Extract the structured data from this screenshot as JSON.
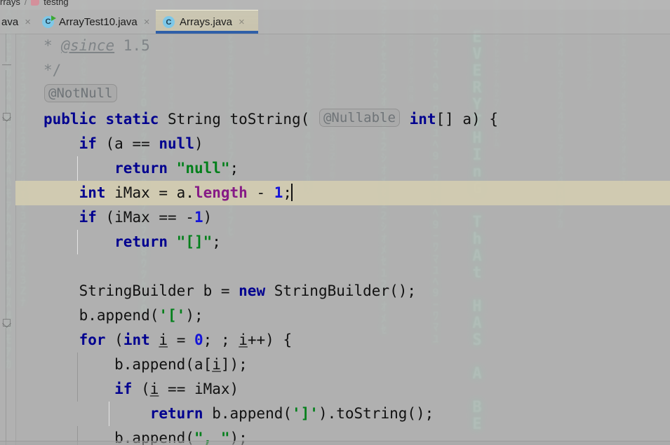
{
  "window": {
    "app": "IntelliJ IDEA Editor",
    "background_effect": "matrix-digital-rain"
  },
  "breadcrumb": {
    "items": [
      {
        "label": "rrays",
        "icon": "folder-icon"
      },
      {
        "label": "testng",
        "icon": "folder-icon"
      }
    ],
    "separator": "/"
  },
  "tabs": [
    {
      "label": "ava",
      "icon": "java-class-icon",
      "active": false,
      "has_run_marker": false,
      "close": "×"
    },
    {
      "label": "ArrayTest10.java",
      "icon": "java-class-icon",
      "active": false,
      "has_run_marker": true,
      "close": "×"
    },
    {
      "label": "Arrays.java",
      "icon": "java-class-icon",
      "active": true,
      "has_run_marker": false,
      "close": "×"
    }
  ],
  "editor": {
    "file": "Arrays.java",
    "language": "Java",
    "caret_line_index": 4,
    "caret_text": "int iMax = a.length - 1;",
    "colors": {
      "keyword": "#00008f",
      "string": "#007f1a",
      "number": "#1414d8",
      "field": "#861b86",
      "comment": "#7f8487",
      "caret_line_bg": "#d4cdb0",
      "editor_bg": "#b0b0b0",
      "active_tab_underline": "#2f5fa8"
    },
    "lines": [
      {
        "tokens": [
          {
            "t": "* ",
            "c": "cmt"
          },
          {
            "t": "@since",
            "c": "cmt-tag"
          },
          {
            "t": " 1.5",
            "c": "cmt"
          }
        ]
      },
      {
        "tokens": [
          {
            "t": "*/",
            "c": "cmt"
          }
        ]
      },
      {
        "tokens": [
          {
            "t": "@NotNull",
            "c": "inlay"
          }
        ]
      },
      {
        "tokens": [
          {
            "t": "public",
            "c": "kw"
          },
          {
            "t": " "
          },
          {
            "t": "static",
            "c": "kw"
          },
          {
            "t": " String toString( "
          },
          {
            "t": "@Nullable",
            "c": "inlay"
          },
          {
            "t": " "
          },
          {
            "t": "int",
            "c": "kw"
          },
          {
            "t": "[] a) {"
          }
        ]
      },
      {
        "tokens": [
          {
            "t": "    "
          },
          {
            "t": "if",
            "c": "kw"
          },
          {
            "t": " (a == "
          },
          {
            "t": "null",
            "c": "kw"
          },
          {
            "t": ")"
          }
        ]
      },
      {
        "tokens": [
          {
            "t": "        "
          },
          {
            "t": "return",
            "c": "kw"
          },
          {
            "t": " "
          },
          {
            "t": "\"null\"",
            "c": "str"
          },
          {
            "t": ";"
          }
        ]
      },
      {
        "tokens": [
          {
            "t": "    "
          },
          {
            "t": "int",
            "c": "kw"
          },
          {
            "t": " iMax = a."
          },
          {
            "t": "length",
            "c": "fld"
          },
          {
            "t": " - "
          },
          {
            "t": "1",
            "c": "num"
          },
          {
            "t": ";"
          }
        ]
      },
      {
        "tokens": [
          {
            "t": "    "
          },
          {
            "t": "if",
            "c": "kw"
          },
          {
            "t": " (iMax == -"
          },
          {
            "t": "1",
            "c": "num"
          },
          {
            "t": ")"
          }
        ]
      },
      {
        "tokens": [
          {
            "t": "        "
          },
          {
            "t": "return",
            "c": "kw"
          },
          {
            "t": " "
          },
          {
            "t": "\"[]\"",
            "c": "str"
          },
          {
            "t": ";"
          }
        ]
      },
      {
        "tokens": [
          {
            "t": ""
          }
        ]
      },
      {
        "tokens": [
          {
            "t": "    StringBuilder b = "
          },
          {
            "t": "new",
            "c": "kw"
          },
          {
            "t": " StringBuilder();"
          }
        ]
      },
      {
        "tokens": [
          {
            "t": "    b.append("
          },
          {
            "t": "'['",
            "c": "str"
          },
          {
            "t": ");"
          }
        ]
      },
      {
        "tokens": [
          {
            "t": "    "
          },
          {
            "t": "for",
            "c": "kw"
          },
          {
            "t": " ("
          },
          {
            "t": "int",
            "c": "kw"
          },
          {
            "t": " "
          },
          {
            "t": "i",
            "c": "ident-u"
          },
          {
            "t": " = "
          },
          {
            "t": "0",
            "c": "num"
          },
          {
            "t": "; ; "
          },
          {
            "t": "i",
            "c": "ident-u"
          },
          {
            "t": "++) {"
          }
        ]
      },
      {
        "tokens": [
          {
            "t": "        b.append(a["
          },
          {
            "t": "i",
            "c": "ident-u"
          },
          {
            "t": "]);"
          }
        ]
      },
      {
        "tokens": [
          {
            "t": "        "
          },
          {
            "t": "if",
            "c": "kw"
          },
          {
            "t": " ("
          },
          {
            "t": "i",
            "c": "ident-u"
          },
          {
            "t": " == iMax)"
          }
        ]
      },
      {
        "tokens": [
          {
            "t": "            "
          },
          {
            "t": "return",
            "c": "kw"
          },
          {
            "t": " b.append("
          },
          {
            "t": "']'",
            "c": "str"
          },
          {
            "t": ").toString();"
          }
        ]
      },
      {
        "tokens": [
          {
            "t": "        b.append("
          },
          {
            "t": "\", \"",
            "c": "str"
          },
          {
            "t": ");"
          }
        ]
      }
    ]
  },
  "gutter": {
    "fold_markers": [
      "fold-collapse-icon",
      "fold-expand-icon",
      "fold-expand-icon"
    ]
  },
  "matrix_rain": {
    "message_column": "EVERYTHInG ThAt HAS A BE",
    "glyph_pool": "ﾊﾐﾋｰｳｼﾅﾓﾆｻﾜﾂｵﾘｱﾎﾃﾏｹﾒｴｶｷﾑﾕﾗｾﾈｽﾀﾇﾍ013457982Z",
    "color": "#b7f5d8"
  }
}
